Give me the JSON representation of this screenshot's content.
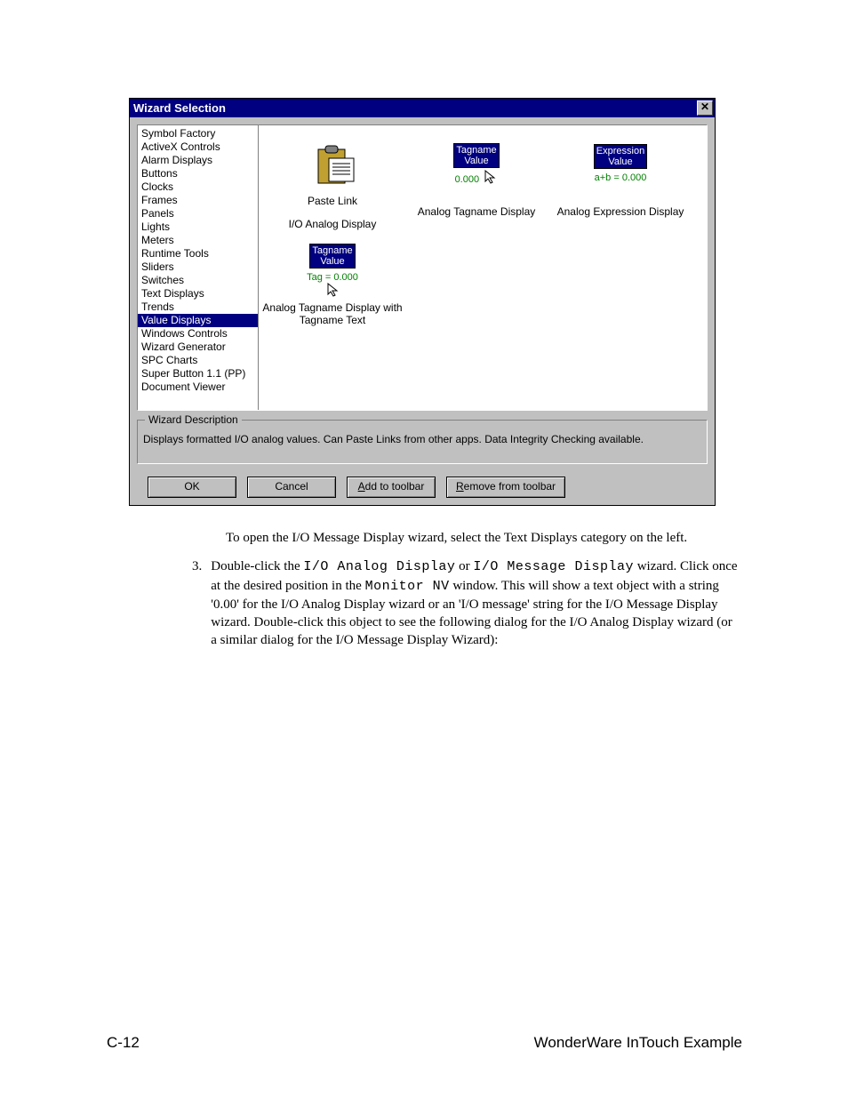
{
  "dialog": {
    "title": "Wizard Selection",
    "close_glyph": "✕",
    "categories": [
      "Symbol Factory",
      "ActiveX Controls",
      "Alarm Displays",
      "Buttons",
      "Clocks",
      "Frames",
      "Panels",
      "Lights",
      "Meters",
      "Runtime Tools",
      "Sliders",
      "Switches",
      "Text Displays",
      "Trends",
      "Value Displays",
      "Windows Controls",
      "Wizard Generator",
      "SPC Charts",
      "Super Button 1.1 (PP)",
      "Document Viewer"
    ],
    "selected_index": 14,
    "wizards": [
      {
        "icon": "paste-link",
        "label": "I/O Analog Display",
        "sub": "Paste Link"
      },
      {
        "icon": "tagname-value",
        "tag_title": "Tagname",
        "tag_sub": "Value",
        "extra": "0.000",
        "label": "Analog Tagname Display"
      },
      {
        "icon": "expression",
        "tag_title": "Expression",
        "tag_sub": "Value",
        "extra": "a+b = 0.000",
        "label": "Analog Expression Display"
      },
      {
        "icon": "tagname-text",
        "tag_title": "Tagname",
        "tag_sub": "Value",
        "extra": "Tag = 0.000",
        "label": "Analog Tagname Display with Tagname Text"
      }
    ],
    "desc_legend": "Wizard Description",
    "desc_text": "Displays formatted I/O analog values.  Can Paste Links from other apps.  Data Integrity Checking available.",
    "buttons": {
      "ok": "OK",
      "cancel": "Cancel",
      "add": "Add to toolbar",
      "add_u": "A",
      "remove": "Remove from  toolbar",
      "remove_u": "R"
    }
  },
  "prose": {
    "p1": "To open the I/O Message Display wizard, select the Text Displays category on the left.",
    "step_num": "3.",
    "p2_a": "Double-click the ",
    "p2_code1": "I/O Analog Display",
    "p2_b": " or ",
    "p2_code2": "I/O Message Display",
    "p2_c": " wizard.  Click once at the desired position in the ",
    "p2_code3": "Monitor NV",
    "p2_d": " window.  This will show a text object with a string '0.00' for the I/O Analog Display wizard or an 'I/O message' string for the I/O Message Display wizard. Double-click this object to see the following dialog for the I/O Analog Display wizard (or a similar dialog for the I/O Message Display Wizard):"
  },
  "footer": {
    "left": "C-12",
    "right": "WonderWare InTouch Example"
  }
}
